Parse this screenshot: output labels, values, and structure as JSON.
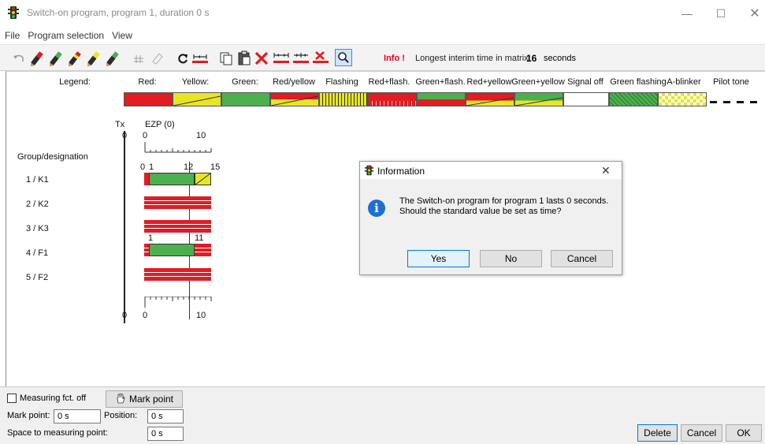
{
  "window": {
    "title": "Switch-on program, program 1, duration 0 s",
    "controls": {
      "minimize": "—",
      "maximize": "☐",
      "close": "✕"
    }
  },
  "menu": [
    "File",
    "Program selection",
    "View"
  ],
  "toolbar": {
    "info_label": "Info !",
    "info_text": "Longest interim time in matrix:",
    "info_value": "16",
    "info_unit": "seconds",
    "icons": [
      "undo-icon",
      "pencil-red-icon",
      "pencil-green-icon",
      "pencil-redyellow-icon",
      "pencil-yellow-icon",
      "pencil-green2-icon",
      "grid-pencil-icon",
      "eraser-icon",
      "rotate-icon",
      "interval-icon",
      "copy-icon",
      "paste-icon",
      "delete-icon",
      "stretch-icon",
      "compress-icon",
      "clear-icon",
      "zoom-icon"
    ]
  },
  "legend": {
    "title": "Legend:",
    "items": [
      {
        "label": "Red:",
        "color": "#e01c24"
      },
      {
        "label": "Yellow:",
        "color": "#e9e524"
      },
      {
        "label": "Green:",
        "color": "#4cb04f"
      },
      {
        "label": "Red/yellow",
        "color": "#e01c24"
      },
      {
        "label": "Flashing",
        "color": "#e9e524"
      },
      {
        "label": "Red+flash.",
        "color": "#e01c24"
      },
      {
        "label": "Green+flash.",
        "color": "#4cb04f"
      },
      {
        "label": "Red+yellow",
        "color": "#e01c24"
      },
      {
        "label": "Green+yellow",
        "color": "#4cb04f"
      },
      {
        "label": "Signal off",
        "color": "#ffffff"
      },
      {
        "label": "Green flashing",
        "color": "#4cb04f"
      },
      {
        "label": "A-blinker",
        "color": "#e9e524"
      },
      {
        "label": "Pilot tone",
        "color": "#000000"
      }
    ]
  },
  "timeline": {
    "tx_label": "Tx",
    "ezp_label": "EZP (0)",
    "scale_top": {
      "start": "0",
      "mark": "10"
    },
    "row_markers": {
      "a": "0",
      "b": "1",
      "c": "12",
      "d": "15"
    },
    "f1_markers": {
      "a": "1",
      "b": "11"
    },
    "scale_bottom": {
      "start": "0",
      "mark": "10"
    },
    "tx_zero_top": "0",
    "tx_zero_bottom": "0"
  },
  "groups": {
    "header": "Group/designation",
    "rows": [
      {
        "label": "1 / K1"
      },
      {
        "label": "2 / K2"
      },
      {
        "label": "3 / K3"
      },
      {
        "label": "4 / F1"
      },
      {
        "label": "5 / F2"
      }
    ]
  },
  "dialog": {
    "title": "Information",
    "message_line1": "The Switch-on program for program 1 lasts 0 seconds.",
    "message_line2": "Should the standard value be set as time?",
    "yes": "Yes",
    "no": "No",
    "cancel": "Cancel",
    "close": "✕"
  },
  "bottom": {
    "measuring_label": "Measuring fct. off",
    "measuring_checked": false,
    "mark_point_button": "Mark point",
    "mark_point_label": "Mark point:",
    "mark_point_value": "0 s",
    "position_label": "Position:",
    "position_value": "0 s",
    "space_label": "Space to measuring point:",
    "space_value": "0 s",
    "delete_button": "Delete",
    "cancel_button": "Cancel",
    "ok_button": "OK"
  }
}
